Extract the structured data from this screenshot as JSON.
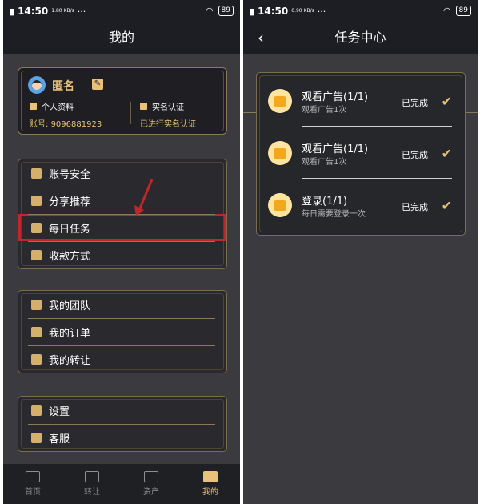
{
  "left_screen": {
    "status": {
      "time": "14:50",
      "speed": "1.80\nKB/s",
      "dots": "···",
      "battery": "89"
    },
    "title": "我的",
    "profile": {
      "name": "匿名",
      "personal_info_label": "个人资料",
      "account_label": "账号:",
      "account_value": "9096881923",
      "realname_label": "实名认证",
      "realname_status": "已进行实名认证"
    },
    "menu_groups": [
      {
        "items": [
          {
            "label": "账号安全",
            "icon": "shield-icon"
          },
          {
            "label": "分享推荐",
            "icon": "gift-icon"
          },
          {
            "label": "每日任务",
            "icon": "calendar-icon"
          },
          {
            "label": "收款方式",
            "icon": "qr-icon"
          }
        ]
      },
      {
        "items": [
          {
            "label": "我的团队",
            "icon": "team-icon"
          },
          {
            "label": "我的订单",
            "icon": "order-icon"
          },
          {
            "label": "我的转让",
            "icon": "transfer-icon"
          }
        ]
      },
      {
        "items": [
          {
            "label": "设置",
            "icon": "gear-icon"
          },
          {
            "label": "客服",
            "icon": "support-icon"
          }
        ]
      }
    ],
    "bottom_nav": [
      {
        "label": "首页",
        "icon": "home-icon"
      },
      {
        "label": "转让",
        "icon": "transfer-icon"
      },
      {
        "label": "资产",
        "icon": "assets-icon"
      },
      {
        "label": "我的",
        "icon": "profile-icon"
      }
    ]
  },
  "right_screen": {
    "status": {
      "time": "14:50",
      "speed": "0.90\nKB/s",
      "dots": "···",
      "battery": "89"
    },
    "title": "任务中心",
    "tasks": [
      {
        "title": "观看广告(1/1)",
        "desc": "观看广告1次",
        "status": "已完成"
      },
      {
        "title": "观看广告(1/1)",
        "desc": "观看广告1次",
        "status": "已完成"
      },
      {
        "title": "登录(1/1)",
        "desc": "每日需要登录一次",
        "status": "已完成"
      }
    ]
  },
  "colors": {
    "gold": "#e8c27a",
    "panel_bg": "#3b3b3f",
    "bar_bg": "#1d1e24",
    "highlight_red": "#c0262a"
  }
}
